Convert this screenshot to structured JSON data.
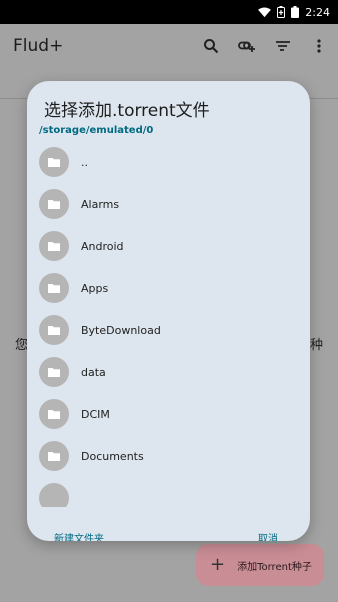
{
  "status_bar": {
    "time": "2:24",
    "icons": [
      "wifi-icon",
      "battery-saver-icon",
      "battery-icon"
    ]
  },
  "app_bar": {
    "title": "Flud+",
    "actions": [
      "search-icon",
      "add-link-icon",
      "sort-icon",
      "more-vert-icon"
    ]
  },
  "background": {
    "left_text": "您",
    "right_text": "种"
  },
  "fab": {
    "label": "添加Torrent种子",
    "icon": "plus-icon"
  },
  "dialog": {
    "title": "选择添加.torrent文件",
    "path": "/storage/emulated/0",
    "items": [
      {
        "label": "..",
        "icon": "folder-icon"
      },
      {
        "label": "Alarms",
        "icon": "folder-icon"
      },
      {
        "label": "Android",
        "icon": "folder-icon"
      },
      {
        "label": "Apps",
        "icon": "folder-icon"
      },
      {
        "label": "ByteDownload",
        "icon": "folder-icon"
      },
      {
        "label": "data",
        "icon": "folder-icon"
      },
      {
        "label": "DCIM",
        "icon": "folder-icon"
      },
      {
        "label": "Documents",
        "icon": "folder-icon"
      }
    ],
    "new_folder_label": "新建文件夹",
    "cancel_label": "取消"
  },
  "colors": {
    "accent": "#006a81",
    "dialog_bg": "#dde5ee",
    "scrim": "#a3a3a3",
    "fab_bg": "#c98d95"
  }
}
